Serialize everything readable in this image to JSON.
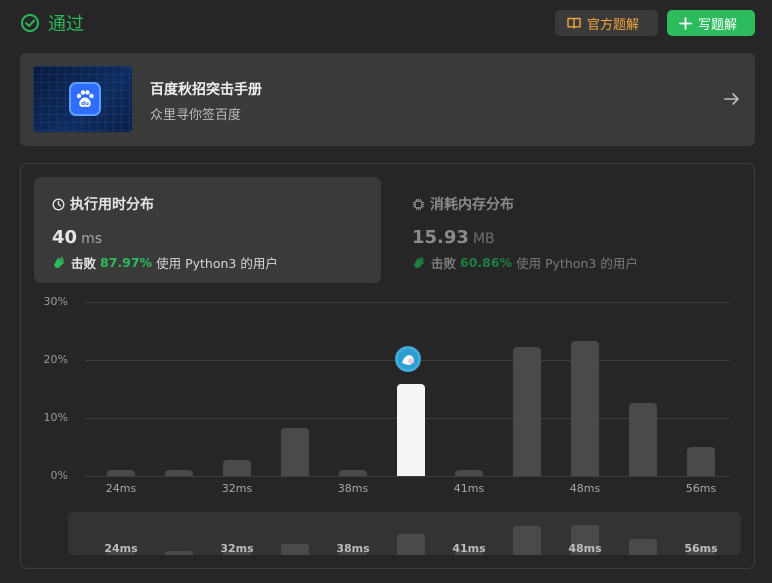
{
  "header": {
    "status_label": "通过",
    "official_solution_label": "官方题解",
    "write_solution_label": "写题解"
  },
  "banner": {
    "title": "百度秋招突击手册",
    "subtitle": "众里寻你签百度"
  },
  "runtime_card": {
    "title": "执行用时分布",
    "value": "40",
    "unit": "ms",
    "beat_word": "击败",
    "beat_pct": "87.97%",
    "beat_suffix": "使用 Python3 的用户"
  },
  "memory_card": {
    "title": "消耗内存分布",
    "value": "15.93",
    "unit": "MB",
    "beat_word": "击败",
    "beat_pct": "60.86%",
    "beat_suffix": "使用 Python3 的用户"
  },
  "colors": {
    "accent_green": "#2cbb5d",
    "official_orange": "#f0a63a",
    "bar": "#4a4a4a",
    "bar_highlight": "#f5f5f5"
  },
  "chart_data": {
    "type": "bar",
    "ylabel_ticks": [
      "30%",
      "20%",
      "10%",
      "0%"
    ],
    "ylim": [
      0,
      30
    ],
    "x_tick_labels": [
      "24ms",
      "32ms",
      "38ms",
      "41ms",
      "48ms",
      "56ms"
    ],
    "values": [
      1,
      1,
      2.7,
      8.2,
      1,
      15.8,
      1,
      22.3,
      23.2,
      12.6,
      5
    ],
    "highlight_index": 5,
    "grid": true
  },
  "minimap": {
    "tick_labels": [
      "24ms",
      "32ms",
      "38ms",
      "41ms",
      "48ms",
      "56ms"
    ],
    "values": [
      1,
      1,
      2.7,
      8.2,
      1,
      15.8,
      1,
      22.3,
      23.2,
      12.6,
      5
    ]
  }
}
